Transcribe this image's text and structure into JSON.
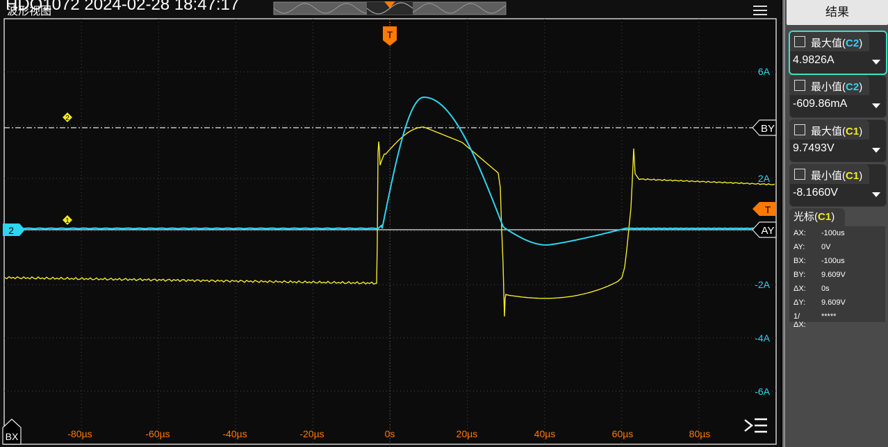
{
  "title_bar": "HDO1072 2024-02-28 18:47:17",
  "view_label": "波形视图",
  "colors": {
    "ch1": "#f3ea23",
    "ch2": "#2ed5f0",
    "trigger": "#ff7a00",
    "grid": "#3a3a3a"
  },
  "axis": {
    "y_labels": [
      "6A",
      "2A",
      "-2A",
      "-4A",
      "-6A"
    ],
    "x_labels": [
      "-80µs",
      "-60µs",
      "-40µs",
      "-20µs",
      "0s",
      "20µs",
      "40µs",
      "60µs",
      "80µs"
    ]
  },
  "markers": {
    "ch1": "1",
    "ch2": "2",
    "ch2_badge": "2",
    "trigger_top": "T",
    "trigger_right": "T",
    "cursor_by": "BY",
    "cursor_ay": "AY",
    "cursor_bx": "BX"
  },
  "icons": {
    "menu": "menu-icon",
    "collapse": "collapse-menu-icon",
    "measure": "pulse-icon"
  },
  "panel": {
    "title": "结果",
    "measurements": [
      {
        "name": "最大值",
        "channel": "C2",
        "value": "4.9826A",
        "selected": true
      },
      {
        "name": "最小值",
        "channel": "C2",
        "value": "-609.86mA",
        "selected": false
      },
      {
        "name": "最大值",
        "channel": "C1",
        "value": "9.7493V",
        "selected": false
      },
      {
        "name": "最小值",
        "channel": "C1",
        "value": "-8.1660V",
        "selected": false
      }
    ],
    "cursor": {
      "title": "光标",
      "channel": "C1",
      "rows": [
        {
          "k": "AX:",
          "v": "-100us"
        },
        {
          "k": "AY:",
          "v": "0V"
        },
        {
          "k": "BX:",
          "v": "-100us"
        },
        {
          "k": "BY:",
          "v": "9.609V"
        },
        {
          "k": "ΔX:",
          "v": "0s"
        },
        {
          "k": "ΔY:",
          "v": "9.609V"
        },
        {
          "k": "1/ΔX:",
          "v": "*****"
        }
      ]
    }
  }
}
